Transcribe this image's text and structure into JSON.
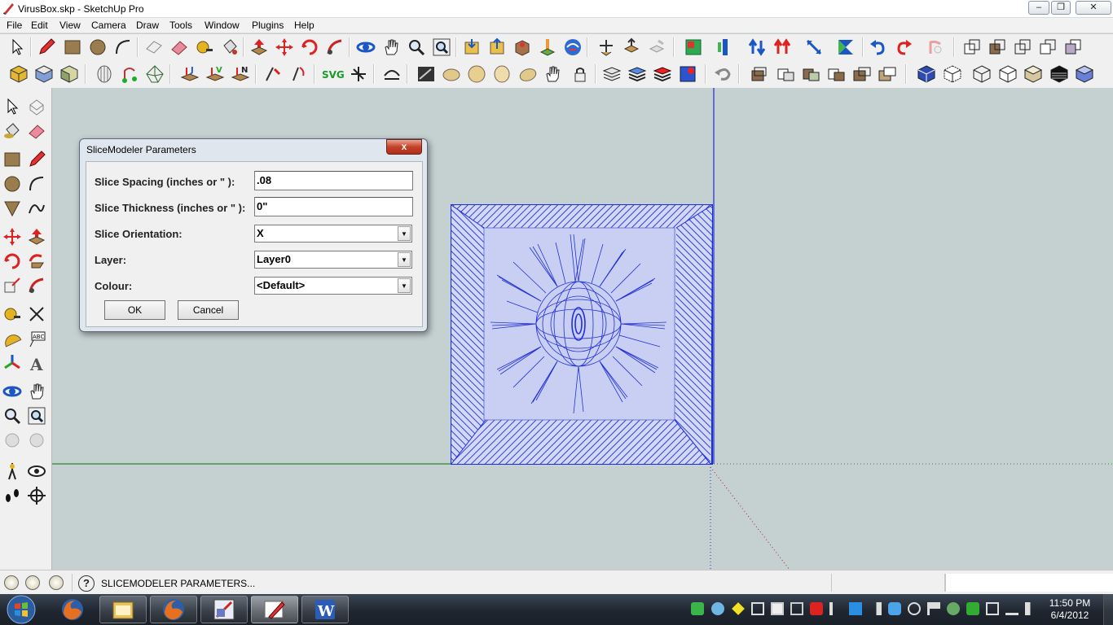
{
  "window": {
    "title": "VirusBox.skp - SketchUp Pro",
    "min": "–",
    "max": "❐",
    "close": "✕"
  },
  "menu": [
    "File",
    "Edit",
    "View",
    "Camera",
    "Draw",
    "Tools",
    "Window",
    "Plugins",
    "Help"
  ],
  "toolbar_row1": [
    "select-icon",
    "pencil-icon",
    "rectangle-icon",
    "circle-icon",
    "arc-icon",
    "eraser-shape-icon",
    "eraser-icon",
    "tape-measure-icon",
    "paint-bucket-icon",
    "push-pull-icon",
    "move-icon",
    "rotate-icon",
    "follow-me-icon",
    "orbit-icon",
    "pan-icon",
    "zoom-icon",
    "zoom-extents-icon",
    "get-models-icon",
    "share-model-icon",
    "components-icon",
    "place-model-icon",
    "google-earth-icon",
    "axes-arrows-icon",
    "share-component-icon",
    "disabled-icon",
    "sandbox-icon",
    "flip-icon",
    "flip-along-icon",
    "slice-icon",
    "scale-icon",
    "mirror-icon",
    "undo-icon",
    "redo-icon",
    "disabled-icon",
    "x-ray-icon",
    "back-edges-icon",
    "wireframe-icon",
    "hidden-line-icon",
    "shaded-icon"
  ],
  "toolbar_row2": [
    "iso-view-icon",
    "top-view-icon",
    "front-view-icon",
    "shell-icon",
    "drape-icon",
    "smoove-icon",
    "join-icon",
    "vertex-icon",
    "normal-icon",
    "align-icon",
    "rotate-face-icon",
    "svg-export-icon",
    "move-tool-icon",
    "curve-icon",
    "blackboard-icon",
    "sphere-icon",
    "ball-icon",
    "egg-icon",
    "hand-icon",
    "lock-icon",
    "layers-icon",
    "layer-stack-icon",
    "red-layers-icon",
    "blue-layers-icon",
    "undo-gray-icon",
    "section-icon",
    "section-plane-icon",
    "section-fill-icon",
    "section-cut-icon",
    "section-display-icon",
    "section-box-icon",
    "view-cube-icon",
    "view-iso-icon",
    "view-outline-icon",
    "view-box-icon",
    "view-shaded-icon",
    "view-dark-icon",
    "view-blue-icon"
  ],
  "left_toolbar": [
    "select-icon",
    "make-component-icon",
    "paint-bucket-icon",
    "eraser-icon",
    "rectangle-icon",
    "pencil-icon",
    "circle-icon",
    "arc-icon",
    "polygon-icon",
    "freehand-icon",
    "move-icon",
    "push-pull-icon",
    "rotate-icon",
    "follow-me-icon",
    "scale-icon",
    "offset-icon",
    "tape-measure-icon",
    "dimension-icon",
    "protractor-icon",
    "text-icon",
    "axes-icon",
    "3d-text-icon",
    "orbit-icon",
    "pan-icon",
    "zoom-icon",
    "zoom-window-icon",
    "previous-view-icon",
    "next-view-icon",
    "position-camera-icon",
    "look-around-icon",
    "walk-icon",
    "section-plane-icon"
  ],
  "dialog": {
    "title": "SliceModeler Parameters",
    "close": "x",
    "fields": [
      {
        "label": "Slice Spacing (inches or \" ):",
        "value": ".08"
      },
      {
        "label": "Slice Thickness (inches or \" ):",
        "value": "0\""
      },
      {
        "label": "Slice Orientation:",
        "value": "X"
      },
      {
        "label": "Layer:",
        "value": "Layer0"
      },
      {
        "label": "Colour:",
        "value": "<Default>"
      }
    ],
    "ok": "OK",
    "cancel": "Cancel"
  },
  "status": {
    "help": "?",
    "text": "SLICEMODELER PARAMETERS..."
  },
  "clock": {
    "time": "11:50 PM",
    "date": "6/4/2012"
  },
  "taskbar_apps": [
    "firefox-icon",
    "explorer-icon",
    "firefox-icon",
    "sketchup-icon",
    "paint-icon",
    "word-icon"
  ],
  "colors": {
    "canvas": "#c5d0d0",
    "model_blue": "#2233dd",
    "model_fill": "#c8cef0"
  }
}
